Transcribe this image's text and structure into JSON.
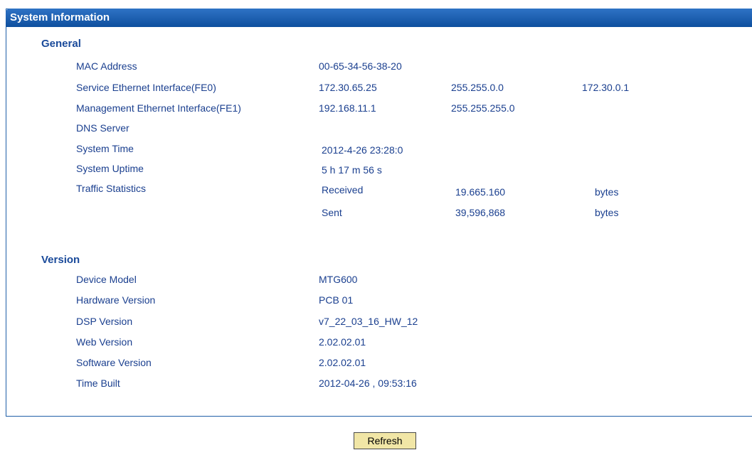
{
  "panel": {
    "title": "System Information"
  },
  "general": {
    "title": "General",
    "mac_label": "MAC Address",
    "mac_value": "00-65-34-56-38-20",
    "fe0_label": "Service Ethernet Interface(FE0)",
    "fe0_ip": "172.30.65.25",
    "fe0_mask": "255.255.0.0",
    "fe0_gateway": "172.30.0.1",
    "fe1_label": "Management Ethernet Interface(FE1)",
    "fe1_ip": "192.168.11.1",
    "fe1_mask": "255.255.255.0",
    "dns_label": "DNS Server",
    "time_label": "System Time",
    "time_value": "2012-4-26 23:28:0",
    "uptime_label": "System Uptime",
    "uptime_value": "5 h 17 m 56 s",
    "traffic_label": "Traffic Statistics",
    "received_label": "Received",
    "received_value": "19.665.160",
    "received_unit": "bytes",
    "sent_label": "Sent",
    "sent_value": "39,596,868",
    "sent_unit": "bytes"
  },
  "version": {
    "title": "Version",
    "model_label": "Device Model",
    "model_value": "MTG600",
    "hw_label": "Hardware Version",
    "hw_value": "PCB 01",
    "dsp_label": "DSP Version",
    "dsp_value": "v7_22_03_16_HW_12",
    "web_label": "Web Version",
    "web_value": "2.02.02.01",
    "sw_label": "Software Version",
    "sw_value": "2.02.02.01",
    "built_label": "Time Built",
    "built_value": "2012-04-26 , 09:53:16"
  },
  "actions": {
    "refresh_label": "Refresh"
  },
  "colors": {
    "header": "#1f5fa8",
    "text": "#1a3f8f",
    "button": "#f1e6a6"
  }
}
